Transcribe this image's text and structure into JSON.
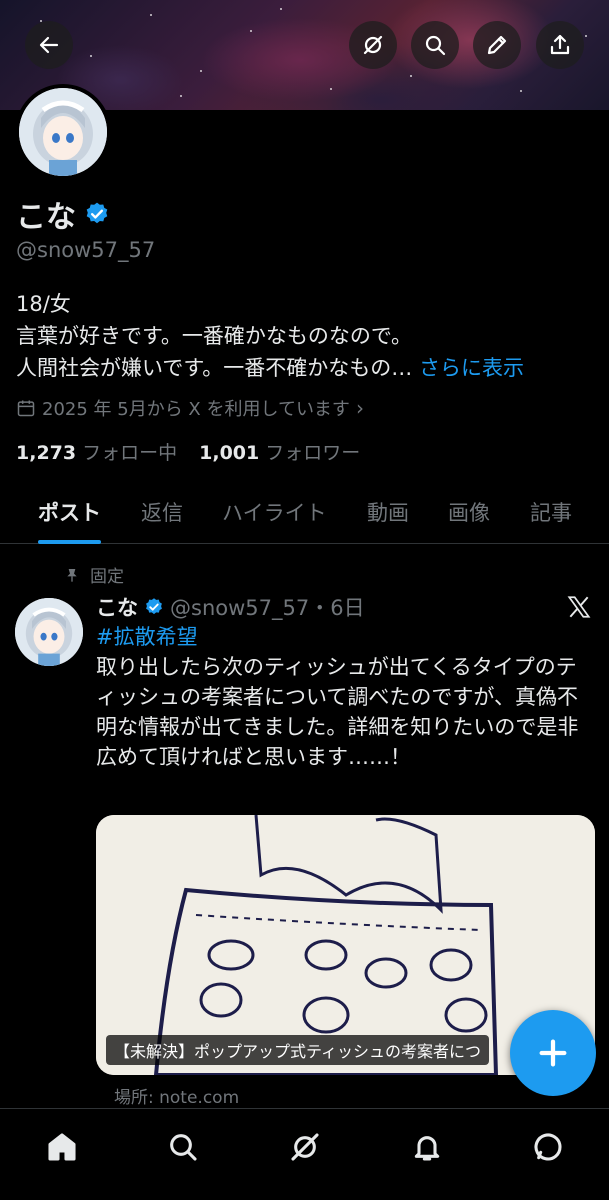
{
  "profile": {
    "name": "こな",
    "handle": "@snow57_57",
    "bio_line1": "18/女",
    "bio_line2": "言葉が好きです。一番確かなものなので。",
    "bio_line3": "人間社会が嫌いです。一番不確かなもの…",
    "bio_more": "さらに表示",
    "joined": "2025 年 5月から X を利用しています",
    "following_count": "1,273",
    "following_label": "フォロー中",
    "followers_count": "1,001",
    "followers_label": "フォロワー"
  },
  "tabs": [
    {
      "label": "ポスト",
      "active": true
    },
    {
      "label": "返信",
      "active": false
    },
    {
      "label": "ハイライト",
      "active": false
    },
    {
      "label": "動画",
      "active": false
    },
    {
      "label": "画像",
      "active": false
    },
    {
      "label": "記事",
      "active": false
    }
  ],
  "post": {
    "pinned_label": "固定",
    "author": "こな",
    "handle_time": "@snow57_57・6日",
    "hashtag": "#拡散希望",
    "text": "取り出したら次のティッシュが出てくるタイプのティッシュの考案者について調べたのですが、真偽不明な情報が出てきました。詳細を知りたいので是非広めて頂ければと思います……！",
    "card_caption": "【未解決】ポップアップ式ティッシュの考案者につ",
    "source": "場所: note.com"
  },
  "colors": {
    "accent": "#1d9bf0",
    "text": "#e7e9ea",
    "muted": "#71767b",
    "background": "#000000"
  },
  "icons": {
    "top": [
      "back-arrow-icon",
      "grok-icon",
      "search-icon",
      "edit-icon",
      "share-icon"
    ],
    "nav": [
      "home-icon",
      "search-icon",
      "grok-icon",
      "notifications-icon",
      "messages-icon"
    ]
  }
}
